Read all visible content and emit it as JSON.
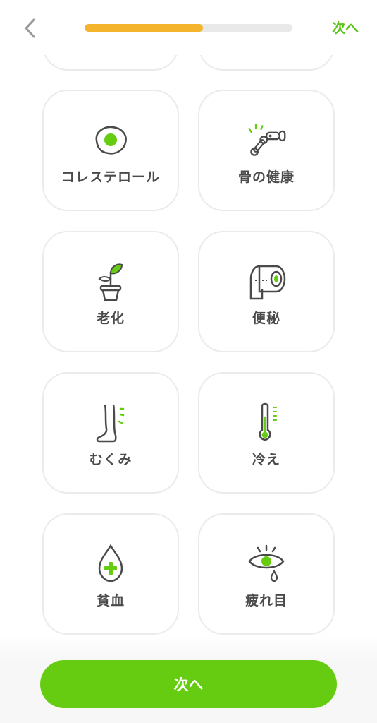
{
  "header": {
    "back_icon": "chevron-left-icon",
    "progress_percent": 57,
    "next_label": "次へ"
  },
  "colors": {
    "accent_green": "#66cc12",
    "progress_yellow": "#f4b52c",
    "icon_stroke": "#4a4a4a"
  },
  "cards": [
    {
      "label": "コレステロール",
      "icon": "fried-egg-icon"
    },
    {
      "label": "骨の健康",
      "icon": "bone-icon"
    },
    {
      "label": "老化",
      "icon": "sprout-pot-icon"
    },
    {
      "label": "便秘",
      "icon": "toilet-paper-icon"
    },
    {
      "label": "むくみ",
      "icon": "leg-icon"
    },
    {
      "label": "冷え",
      "icon": "thermometer-icon"
    },
    {
      "label": "貧血",
      "icon": "blood-drop-cross-icon"
    },
    {
      "label": "疲れ目",
      "icon": "tired-eye-icon"
    }
  ],
  "footer": {
    "primary_button": "次へ"
  }
}
